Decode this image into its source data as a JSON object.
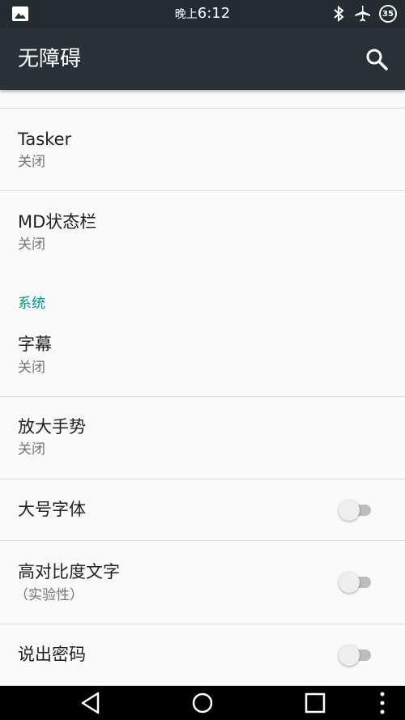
{
  "status_bar": {
    "time_prefix": "晚上",
    "time": "6:12",
    "battery_level": "35",
    "icons": [
      "image-icon",
      "bluetooth-icon",
      "airplane-mode-icon",
      "battery-icon"
    ]
  },
  "app_bar": {
    "title": "无障碍",
    "search_icon": "search-icon"
  },
  "items": {
    "tasker": {
      "title": "Tasker",
      "subtitle": "关闭"
    },
    "md_statusbar": {
      "title": "MD状态栏",
      "subtitle": "关闭"
    },
    "captions": {
      "title": "字幕",
      "subtitle": "关闭"
    },
    "magnification": {
      "title": "放大手势",
      "subtitle": "关闭"
    },
    "large_text": {
      "title": "大号字体",
      "checked": false
    },
    "high_contrast": {
      "title": "高对比度文字",
      "subtitle": "（实验性）",
      "checked": false
    },
    "speak_passwords": {
      "title": "说出密码",
      "checked": false
    }
  },
  "sections": {
    "system": "系统"
  },
  "nav_bar": {
    "icons": [
      "back-icon",
      "home-icon",
      "recents-icon",
      "menu-icon"
    ]
  },
  "colors": {
    "status_bar": "#222c31",
    "app_bar": "#263238",
    "accent": "#009688",
    "background": "#fafafa"
  }
}
